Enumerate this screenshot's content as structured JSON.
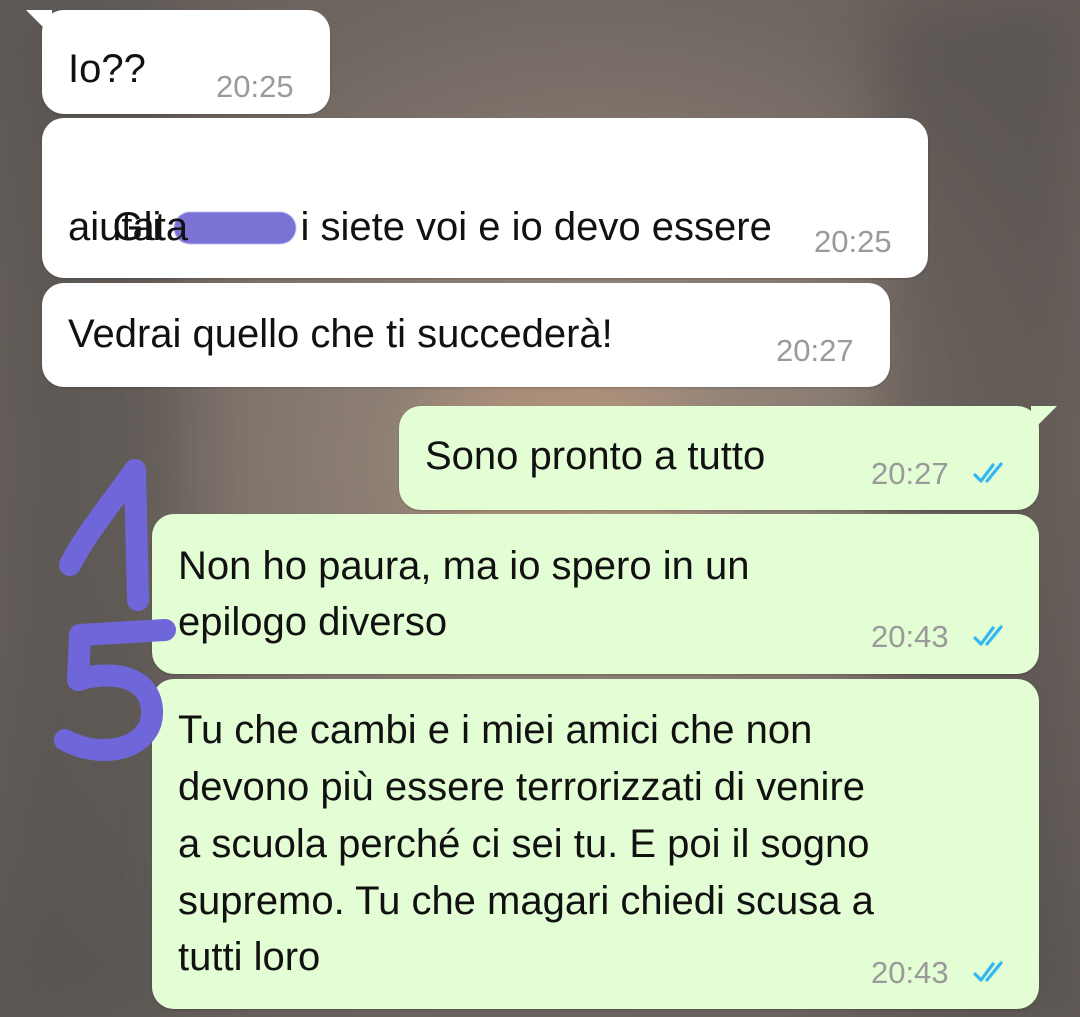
{
  "messages": [
    {
      "direction": "in",
      "text": "Io??",
      "time": "20:25"
    },
    {
      "direction": "in",
      "text_before": "Gli ",
      "text_after": "i siete voi e io devo essere",
      "text_line2": "aiutata",
      "time": "20:25"
    },
    {
      "direction": "in",
      "text": "Vedrai quello che ti succederà!",
      "time": "20:27"
    },
    {
      "direction": "out",
      "text": "Sono pronto a tutto",
      "time": "20:27",
      "status": "read"
    },
    {
      "direction": "out",
      "lines": [
        "Non ho paura, ma io spero in un",
        "epilogo diverso"
      ],
      "time": "20:43",
      "status": "read"
    },
    {
      "direction": "out",
      "lines": [
        "Tu che cambi e i miei amici che non",
        "devono più essere terrorizzati di venire",
        "a scuola perché ci sei tu. E poi il sogno",
        "supremo. Tu che magari chiedi scusa a",
        "tutti loro"
      ],
      "time": "20:43",
      "status": "read"
    }
  ],
  "annotation": {
    "text": "15",
    "color": "#6f67d9"
  },
  "colors": {
    "incoming_bubble": "#ffffff",
    "outgoing_bubble": "#e3fdd4",
    "read_ticks": "#34b7f1",
    "timestamp": "#9a9a9a",
    "redaction": "#7b72d6"
  },
  "icons": {
    "read_status": "double-check-icon"
  }
}
